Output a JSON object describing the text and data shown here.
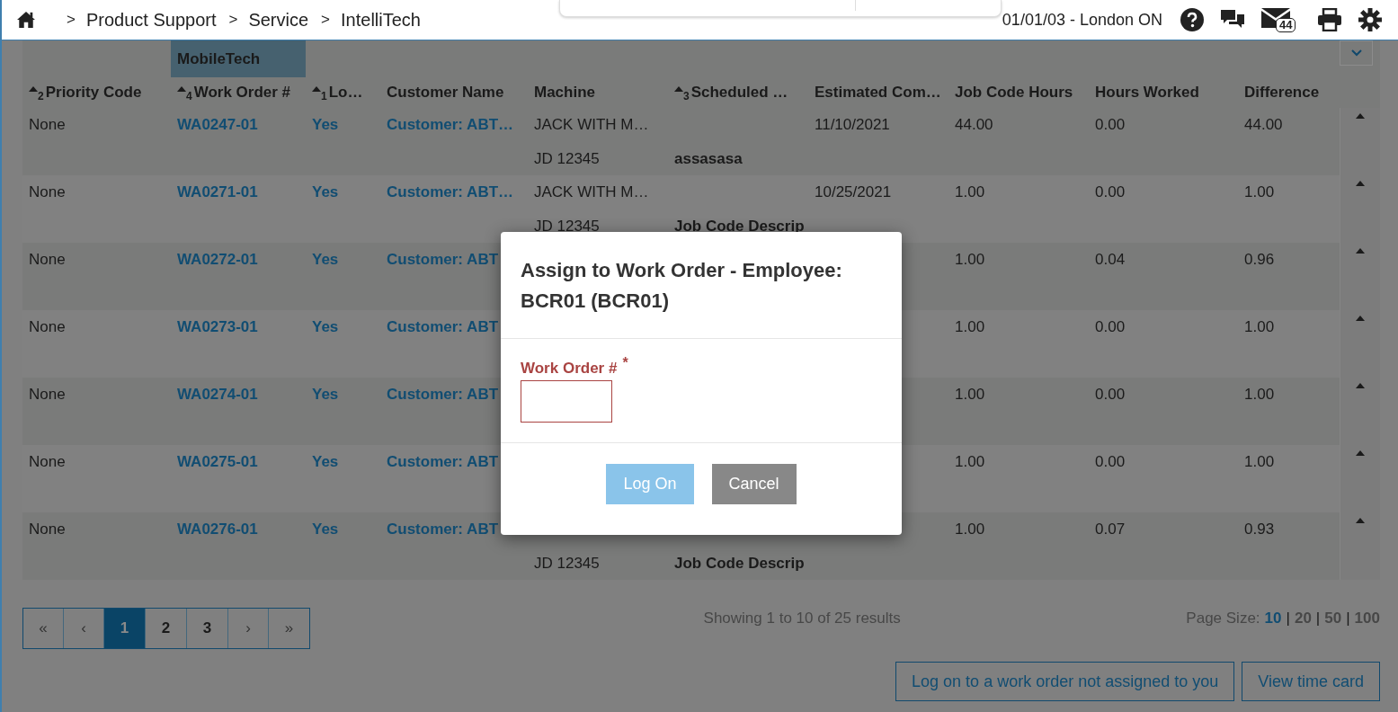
{
  "header": {
    "breadcrumb": [
      {
        "separator": ">",
        "label": "Product Support"
      },
      {
        "separator": ">",
        "label": "Service"
      },
      {
        "separator": ">",
        "label": "IntelliTech"
      }
    ],
    "location": "01/01/03 - London ON",
    "mail_count": "44"
  },
  "table": {
    "group_header": "MobileTech",
    "columns": [
      {
        "label": "Priority Code",
        "sort_order": "2"
      },
      {
        "label": "Work Order #",
        "sort_order": "4"
      },
      {
        "label": "Lo…",
        "sort_order": "1"
      },
      {
        "label": "Customer Name"
      },
      {
        "label": "Machine"
      },
      {
        "label": "Scheduled …",
        "sort_order": "3"
      },
      {
        "label": "Estimated Com…"
      },
      {
        "label": "Job Code Hours"
      },
      {
        "label": "Hours Worked"
      },
      {
        "label": "Difference"
      }
    ],
    "rows": [
      {
        "priority": "None",
        "work_order": "WA0247-01",
        "lo": "Yes",
        "customer": "Customer: ABT…",
        "machine": "JACK WITH M…",
        "machine_id": "JD 12345",
        "job_code_description": "assasasa",
        "estimated_completion": "11/10/2021",
        "job_code_hours": "44.00",
        "hours_worked": "0.00",
        "difference": "44.00"
      },
      {
        "priority": "None",
        "work_order": "WA0271-01",
        "lo": "Yes",
        "customer": "Customer: ABT…",
        "machine": "JACK WITH M…",
        "machine_id": "JD 12345",
        "job_code_description": "Job Code Descrip",
        "estimated_completion": "10/25/2021",
        "job_code_hours": "1.00",
        "hours_worked": "0.00",
        "difference": "1.00"
      },
      {
        "priority": "None",
        "work_order": "WA0272-01",
        "lo": "Yes",
        "customer": "Customer: ABT",
        "job_code_hours": "1.00",
        "hours_worked": "0.04",
        "difference": "0.96"
      },
      {
        "priority": "None",
        "work_order": "WA0273-01",
        "lo": "Yes",
        "customer": "Customer: ABT",
        "job_code_hours": "1.00",
        "hours_worked": "0.00",
        "difference": "1.00"
      },
      {
        "priority": "None",
        "work_order": "WA0274-01",
        "lo": "Yes",
        "customer": "Customer: ABT",
        "job_code_hours": "1.00",
        "hours_worked": "0.00",
        "difference": "1.00"
      },
      {
        "priority": "None",
        "work_order": "WA0275-01",
        "lo": "Yes",
        "customer": "Customer: ABT",
        "job_code_hours": "1.00",
        "hours_worked": "0.00",
        "difference": "1.00"
      },
      {
        "priority": "None",
        "work_order": "WA0276-01",
        "lo": "Yes",
        "customer": "Customer: ABT",
        "machine_id": "JD 12345",
        "job_code_description": "Job Code Descrip",
        "job_code_hours": "1.00",
        "hours_worked": "0.07",
        "difference": "0.93"
      }
    ]
  },
  "pagination": {
    "pages": [
      {
        "label": "«",
        "kind": "nav",
        "selected": false
      },
      {
        "label": "‹",
        "kind": "nav",
        "selected": false
      },
      {
        "label": "1",
        "kind": "page",
        "selected": true
      },
      {
        "label": "2",
        "kind": "page",
        "selected": false
      },
      {
        "label": "3",
        "kind": "page",
        "selected": false
      },
      {
        "label": "›",
        "kind": "nav",
        "selected": false
      },
      {
        "label": "»",
        "kind": "nav",
        "selected": false
      }
    ],
    "summary": "Showing 1 to 10 of 25 results",
    "page_size_label": "Page Size:",
    "page_sizes": [
      {
        "label": "10",
        "selected": true
      },
      {
        "label": "20",
        "selected": false
      },
      {
        "label": "50",
        "selected": false
      },
      {
        "label": "100",
        "selected": false
      }
    ],
    "separator": "|"
  },
  "actions": [
    "Log on to a work order not assigned to you",
    "View time card"
  ],
  "modal": {
    "title": "Assign to Work Order - Employee: BCR01 (BCR01)",
    "field": {
      "label": "Work Order #",
      "required": true,
      "required_mark": "*",
      "invalid": true
    },
    "buttons": [
      {
        "label": "Log On",
        "kind": "primary",
        "disabled": true
      },
      {
        "label": "Cancel",
        "kind": "secondary",
        "disabled": false
      }
    ]
  }
}
